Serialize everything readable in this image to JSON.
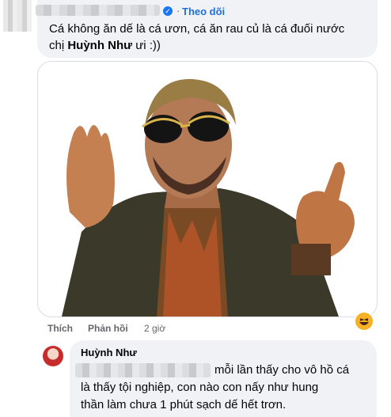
{
  "comment": {
    "follow_label": "Theo dõi",
    "separator": "·",
    "verified_mark": "✓",
    "line1": "Cá không ăn dế là cá ươn, cá ăn rau củ là cá đuối nước",
    "line2_prefix": "chị ",
    "line2_mention": "Huỳnh Như",
    "line2_suffix": " ưi :))"
  },
  "actions": {
    "like": "Thích",
    "reply": "Phản hồi",
    "time": "2 giờ"
  },
  "reply": {
    "name": "Huỳnh Như",
    "line1": "mỗi lần thấy cho vô hồ cá",
    "line2": "là thấy tội nghiệp, con nào con nấy như hung",
    "line3": "thần làm chưa 1 phút sạch dế hết trơn."
  },
  "colors": {
    "bubble": "#f0f2f5",
    "link": "#216fdb",
    "meta": "#65676b"
  }
}
